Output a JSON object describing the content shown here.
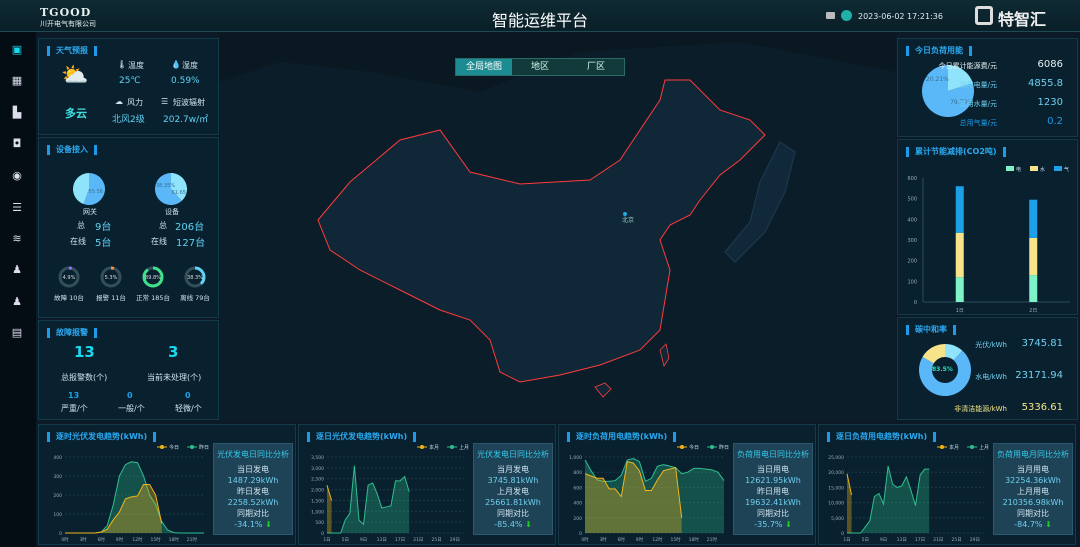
{
  "header": {
    "logo_text": "TGOOD",
    "company": "川开电气有限公司",
    "title": "智能运维平台",
    "datetime": "2023-06-02 17:21:36",
    "brand": "特智汇",
    "icons": [
      "monitor-icon",
      "user-icon"
    ]
  },
  "sidebar": {
    "icons": [
      "fullscreen-icon",
      "dashboard-icon",
      "building-icon",
      "device-icon",
      "target-icon",
      "server-icon",
      "layers-icon",
      "user-icon",
      "user-alt-icon",
      "report-icon"
    ]
  },
  "colors": {
    "accent": "#1e9be8",
    "today": "#f2b418",
    "yesterday": "#2fbf8f",
    "elec": "#7ff2c8",
    "water": "#f7e38a",
    "gas": "#1ea0e8"
  },
  "weather": {
    "title": "天气预报",
    "condition": "多云",
    "temp_label": "温度",
    "temp": "25℃",
    "humidity_label": "湿度",
    "humidity": "0.59%",
    "wind_label": "风力",
    "wind": "北风2级",
    "radiation_label": "短波辐射",
    "radiation": "202.7w/㎡"
  },
  "devices": {
    "title": "设备接入",
    "gateway": {
      "label": "网关",
      "pie": [
        55.56,
        44.44
      ],
      "pie_label": "55.56",
      "total_label": "总",
      "total": "9台",
      "online_label": "在线",
      "online": "5台"
    },
    "equipment": {
      "label": "设备",
      "pie": [
        38.35,
        61.65
      ],
      "pie_labels": [
        "38.35%",
        "61.65"
      ],
      "total_label": "总",
      "total": "206台",
      "online_label": "在线",
      "online": "127台"
    },
    "rings": [
      {
        "pct": 4.9,
        "text": "4.9%",
        "label": "故障 10台",
        "color": "#9a6bff"
      },
      {
        "pct": 5.3,
        "text": "5.3%",
        "label": "报警 11台",
        "color": "#ff8a3d"
      },
      {
        "pct": 89.8,
        "text": "89.8%",
        "label": "正常 185台",
        "color": "#3fe08a"
      },
      {
        "pct": 38.3,
        "text": "38.3%",
        "label": "离线 79台",
        "color": "#5fd3f5"
      }
    ]
  },
  "faults": {
    "title": "故障报警",
    "total": "13",
    "total_label": "总报警数(个)",
    "pending": "3",
    "pending_label": "当前未处理(个)",
    "levels": [
      {
        "v": "13",
        "l": "严重/个"
      },
      {
        "v": "0",
        "l": "一般/个"
      },
      {
        "v": "0",
        "l": "轻微/个"
      }
    ]
  },
  "map": {
    "tabs": [
      "全局地图",
      "地区",
      "厂区"
    ],
    "active": 0,
    "city": "北京"
  },
  "load": {
    "title": "今日负荷用能",
    "pie": [
      20.21,
      79.79
    ],
    "pie_labels": [
      "20.21%",
      "79.79%"
    ],
    "rows": [
      {
        "l": "今日累计能源费/元",
        "v": "6086"
      },
      {
        "l": "总用电量/元",
        "v": "4855.8"
      },
      {
        "l": "总用水量/元",
        "v": "1230"
      },
      {
        "l": "总用气量/元",
        "v": "0.2"
      }
    ]
  },
  "saving": {
    "title": "累计节能减排(CO2吨)"
  },
  "carbon": {
    "title": "碳中和率",
    "center": "83.5%",
    "rows": [
      {
        "l": "光伏/kWh",
        "v": "3745.81"
      },
      {
        "l": "水电/kWh",
        "v": "23171.94"
      },
      {
        "l": "非清洁能源/kWh",
        "v": "5336.61"
      }
    ]
  },
  "bottom": [
    {
      "title": "逐时光伏发电趋势(kWh)",
      "box": {
        "title": "光伏发电日同比分析",
        "a_l": "当日发电",
        "a_v": "1487.29kWh",
        "b_l": "昨日发电",
        "b_v": "2258.52kWh",
        "c_l": "同期对比",
        "c_v": "-34.1%"
      }
    },
    {
      "title": "逐日光伏发电趋势(kWh)",
      "box": {
        "title": "光伏发电日同比分析",
        "a_l": "当月发电",
        "a_v": "3745.81kWh",
        "b_l": "上月发电",
        "b_v": "25661.81kWh",
        "c_l": "同期对比",
        "c_v": "-85.4%"
      }
    },
    {
      "title": "逐时负荷用电趋势(kWh)",
      "box": {
        "title": "负荷用电日同比分析",
        "a_l": "当日用电",
        "a_v": "12621.95kWh",
        "b_l": "昨日用电",
        "b_v": "19632.41kWh",
        "c_l": "同期对比",
        "c_v": "-35.7%"
      }
    },
    {
      "title": "逐日负荷用电趋势(kWh)",
      "box": {
        "title": "负荷用电月同比分析",
        "a_l": "当月用电",
        "a_v": "32254.36kWh",
        "b_l": "上月用电",
        "b_v": "210356.98kWh",
        "c_l": "同期对比",
        "c_v": "-84.7%"
      }
    }
  ],
  "chart_data": [
    {
      "type": "bar",
      "stacked": true,
      "categories": [
        "1日",
        "2日"
      ],
      "ylim": [
        0,
        600
      ],
      "yticks": [
        0,
        100,
        200,
        300,
        400,
        500,
        600
      ],
      "series": [
        {
          "name": "电",
          "values": [
            120,
            130
          ]
        },
        {
          "name": "水",
          "values": [
            215,
            180
          ]
        },
        {
          "name": "气",
          "values": [
            225,
            185
          ]
        }
      ],
      "legend": "top-right"
    },
    {
      "type": "area",
      "ylim": [
        0,
        400
      ],
      "yticks": [
        0,
        100,
        200,
        300,
        400
      ],
      "xticks": [
        "0时",
        "3时",
        "6时",
        "9时",
        "12时",
        "15时",
        "18时",
        "21时"
      ],
      "x": "hours 0-23",
      "series": [
        {
          "name": "今日",
          "values": [
            0,
            0,
            0,
            0,
            0,
            0,
            5,
            20,
            70,
            110,
            180,
            190,
            195,
            255,
            255,
            200,
            50
          ]
        },
        {
          "name": "昨日",
          "values": [
            0,
            0,
            0,
            0,
            0,
            0,
            5,
            40,
            150,
            300,
            360,
            375,
            370,
            300,
            200,
            150,
            60,
            15,
            2,
            0,
            0,
            0,
            0,
            0
          ]
        }
      ],
      "legend": "top-right"
    },
    {
      "type": "area",
      "ylim": [
        0,
        3500
      ],
      "yticks": [
        0,
        500,
        1000,
        1500,
        2000,
        2500,
        3000,
        3500
      ],
      "xticks": [
        "1日",
        "5日",
        "9日",
        "13日",
        "17日",
        "21日",
        "25日",
        "29日"
      ],
      "x": "days 1-31",
      "series": [
        {
          "name": "本月",
          "values": [
            2200,
            1500
          ]
        },
        {
          "name": "上月",
          "values": [
            0,
            0,
            0,
            0,
            600,
            900,
            3100,
            600,
            400,
            2200,
            2300,
            1800,
            1150,
            1200,
            1250,
            2400,
            2400,
            2600,
            1900
          ]
        }
      ],
      "legend": "top-right"
    },
    {
      "type": "area",
      "ylim": [
        0,
        1000
      ],
      "yticks": [
        0,
        200,
        400,
        600,
        800,
        1000
      ],
      "xticks": [
        "0时",
        "3时",
        "6时",
        "9时",
        "12时",
        "15时",
        "18时",
        "21时"
      ],
      "x": "hours 0-23",
      "series": [
        {
          "name": "今日",
          "values": [
            780,
            750,
            720,
            720,
            580,
            580,
            480,
            940,
            920,
            820,
            560,
            560,
            700,
            820,
            840,
            860,
            200
          ]
        },
        {
          "name": "昨日",
          "values": [
            960,
            820,
            700,
            680,
            680,
            690,
            760,
            960,
            980,
            940,
            680,
            720,
            880,
            900,
            880,
            860,
            780,
            800,
            850,
            850,
            840,
            830,
            800,
            690
          ]
        }
      ],
      "legend": "top-right"
    },
    {
      "type": "area",
      "ylim": [
        0,
        25000
      ],
      "yticks": [
        0,
        5000,
        10000,
        15000,
        20000,
        25000
      ],
      "xticks": [
        "1日",
        "5日",
        "9日",
        "13日",
        "17日",
        "21日",
        "25日",
        "29日"
      ],
      "x": "days 1-31",
      "series": [
        {
          "name": "本月",
          "values": [
            19500,
            12500
          ]
        },
        {
          "name": "上月",
          "values": [
            0,
            0,
            0,
            0,
            2000,
            4000,
            12000,
            13000,
            9500,
            22000,
            16000,
            15000,
            15500,
            18500,
            14000,
            9000,
            19000,
            21000,
            21000
          ]
        }
      ],
      "legend": "top-right"
    }
  ]
}
